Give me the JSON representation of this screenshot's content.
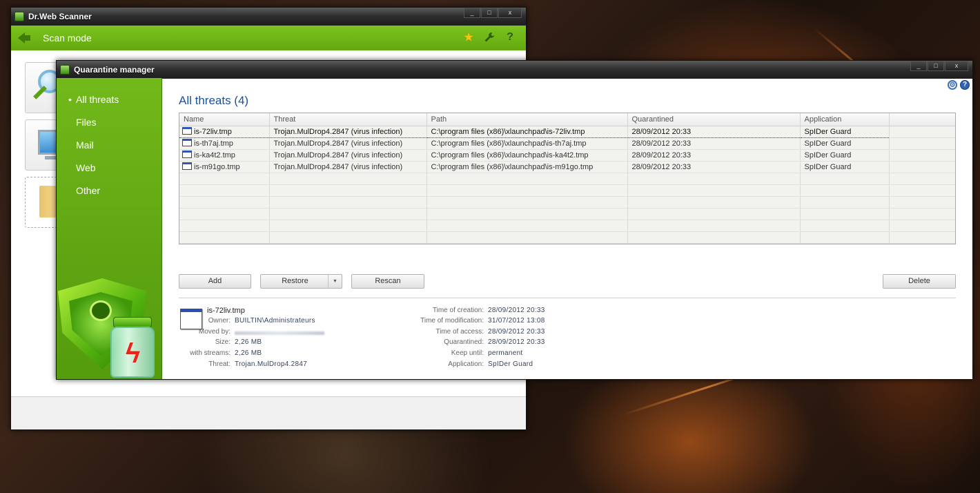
{
  "scanner_window": {
    "title": "Dr.Web Scanner",
    "mode_label": "Scan mode",
    "toolbar_icons": [
      "star-icon",
      "wrench-icon",
      "help-icon"
    ],
    "help_glyph": "?",
    "accent_color": "#6fb617"
  },
  "quarantine_window": {
    "title": "Quarantine manager",
    "window_controls": [
      "_",
      "□",
      "x"
    ],
    "sidebar": {
      "items": [
        {
          "label": "All threats",
          "active": true
        },
        {
          "label": "Files",
          "active": false
        },
        {
          "label": "Mail",
          "active": false
        },
        {
          "label": "Web",
          "active": false
        },
        {
          "label": "Other",
          "active": false
        }
      ]
    },
    "section_title": "All threats (4)",
    "table": {
      "columns": [
        "Name",
        "Threat",
        "Path",
        "Quarantined",
        "Application"
      ],
      "rows": [
        {
          "name": "is-72liv.tmp",
          "threat": "Trojan.MulDrop4.2847 (virus infection)",
          "path": "C:\\program files (x86)\\xlaunchpad\\is-72liv.tmp",
          "quarantined": "28/09/2012 20:33",
          "application": "SpIDer Guard",
          "selected": true
        },
        {
          "name": "is-th7aj.tmp",
          "threat": "Trojan.MulDrop4.2847 (virus infection)",
          "path": "C:\\program files (x86)\\xlaunchpad\\is-th7aj.tmp",
          "quarantined": "28/09/2012 20:33",
          "application": "SpIDer Guard",
          "selected": false
        },
        {
          "name": "is-ka4t2.tmp",
          "threat": "Trojan.MulDrop4.2847 (virus infection)",
          "path": "C:\\program files (x86)\\xlaunchpad\\is-ka4t2.tmp",
          "quarantined": "28/09/2012 20:33",
          "application": "SpIDer Guard",
          "selected": false
        },
        {
          "name": "is-m91go.tmp",
          "threat": "Trojan.MulDrop4.2847 (virus infection)",
          "path": "C:\\program files (x86)\\xlaunchpad\\is-m91go.tmp",
          "quarantined": "28/09/2012 20:33",
          "application": "SpIDer Guard",
          "selected": false
        }
      ]
    },
    "buttons": {
      "add": "Add",
      "restore": "Restore",
      "restore_arrow": "▼",
      "rescan": "Rescan",
      "delete": "Delete"
    },
    "details": {
      "filename": "is-72liv.tmp",
      "left": [
        {
          "key": "Owner:",
          "value": "BUILTIN\\Administrateurs"
        },
        {
          "key": "Moved by:",
          "value": null,
          "redacted": true
        },
        {
          "key": "Size:",
          "value": "2,26 MB"
        },
        {
          "key": "with streams:",
          "value": "2,26 MB"
        },
        {
          "key": "Threat:",
          "value": "Trojan.MulDrop4.2847"
        }
      ],
      "right": [
        {
          "key": "Time of creation:",
          "value": "28/09/2012 20:33"
        },
        {
          "key": "Time of modification:",
          "value": "31/07/2012 13:08"
        },
        {
          "key": "Time of access:",
          "value": "28/09/2012 20:33"
        },
        {
          "key": "Quarantined:",
          "value": "28/09/2012 20:33"
        },
        {
          "key": "Keep until:",
          "value": "permanent"
        },
        {
          "key": "Application:",
          "value": "SpIDer Guard"
        }
      ]
    },
    "header_icons": [
      "settings-icon",
      "info-icon"
    ],
    "info_glyph": "?"
  }
}
